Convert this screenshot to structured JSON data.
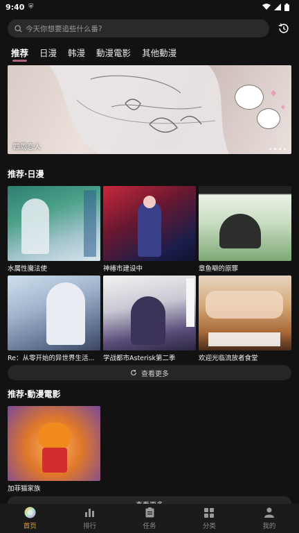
{
  "status": {
    "time": "9:40"
  },
  "search": {
    "placeholder": "今天你想要追些什么番?"
  },
  "tabs": [
    {
      "label": "推荐",
      "active": true
    },
    {
      "label": "日漫",
      "active": false
    },
    {
      "label": "韩漫",
      "active": false
    },
    {
      "label": "動漫電影",
      "active": false
    },
    {
      "label": "其他動漫",
      "active": false
    }
  ],
  "banner": {
    "title": "四周恋人",
    "slide_count": 4
  },
  "section_japan": {
    "title": "推荐·日漫",
    "items": [
      {
        "title": "水属性魔法使"
      },
      {
        "title": "神椿市建设中"
      },
      {
        "title": "章鱼噼的原罪"
      },
      {
        "title": "Re：从零开始的异世界生活..."
      },
      {
        "title": "学战都市Asterisk第二季"
      },
      {
        "title": "欢迎光临流放者食堂"
      }
    ],
    "more_label": "查看更多"
  },
  "section_movie": {
    "title": "推荐·動漫電影",
    "items": [
      {
        "title": "加菲猫家族"
      }
    ],
    "more_label": "查看更多"
  },
  "bottom_nav": [
    {
      "label": "首页",
      "active": true
    },
    {
      "label": "排行",
      "active": false
    },
    {
      "label": "任务",
      "active": false
    },
    {
      "label": "分类",
      "active": false
    },
    {
      "label": "我的",
      "active": false
    }
  ],
  "colors": {
    "accent_nav": "#e3a13a",
    "tab_underline": "#d67a92",
    "background": "#121212"
  }
}
